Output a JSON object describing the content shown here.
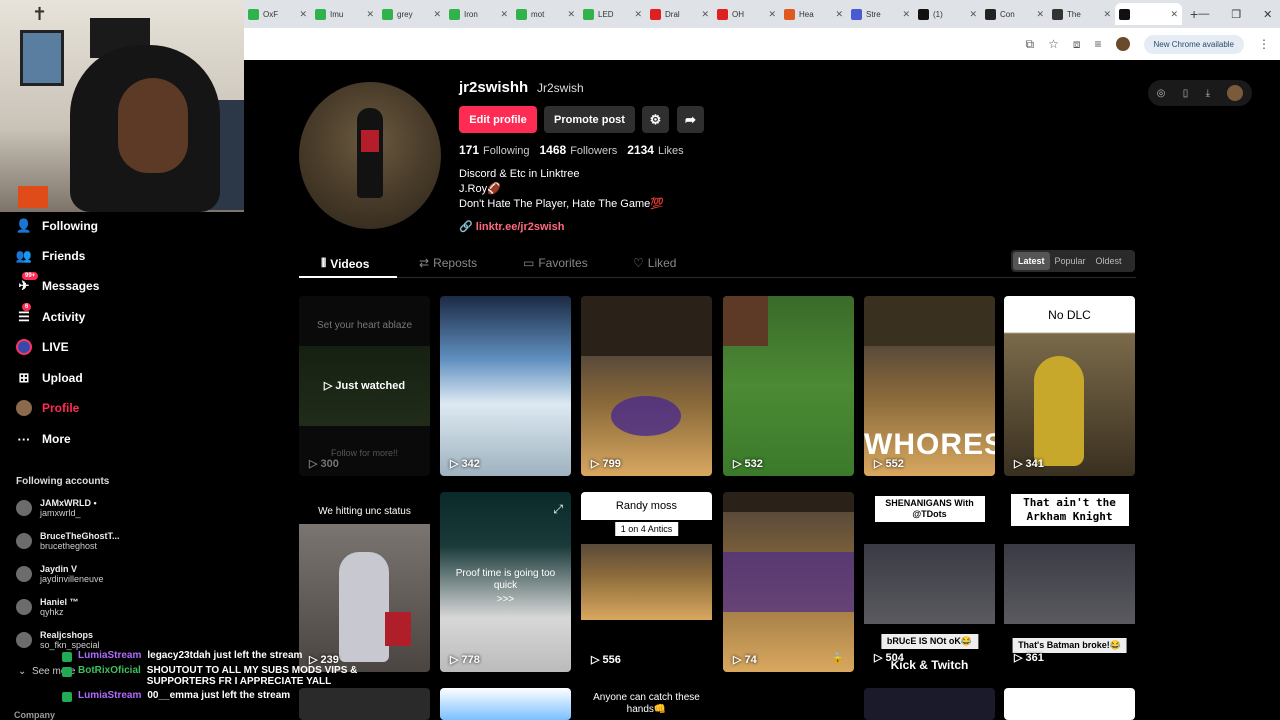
{
  "browser": {
    "tabs": [
      {
        "label": "OxF",
        "color": "#2fb34a"
      },
      {
        "label": "Imu",
        "color": "#2fb34a"
      },
      {
        "label": "grey",
        "color": "#2fb34a"
      },
      {
        "label": "Iron",
        "color": "#2fb34a"
      },
      {
        "label": "mot",
        "color": "#2fb34a"
      },
      {
        "label": "LED",
        "color": "#2fb34a"
      },
      {
        "label": "Dral",
        "color": "#e02020"
      },
      {
        "label": "OH",
        "color": "#e02020"
      },
      {
        "label": "Hea",
        "color": "#e05a20"
      },
      {
        "label": "Stre",
        "color": "#4a5ad0"
      },
      {
        "label": "(1)",
        "color": "#111111"
      },
      {
        "label": "Con",
        "color": "#222222"
      },
      {
        "label": "The",
        "color": "#333333"
      },
      {
        "label": "",
        "color": "#111111"
      }
    ],
    "new_chrome": "New Chrome available"
  },
  "nav": {
    "following": "Following",
    "friends": "Friends",
    "messages": "Messages",
    "messages_badge": "99+",
    "activity": "Activity",
    "activity_badge": "6",
    "live": "LIVE",
    "upload": "Upload",
    "profile": "Profile",
    "more": "More"
  },
  "following_accounts": {
    "title": "Following accounts",
    "items": [
      {
        "name": "JAMxWRLD •",
        "user": "jamxwrld_"
      },
      {
        "name": "BruceTheGhostT...",
        "user": "brucetheghost"
      },
      {
        "name": "Jaydin V",
        "user": "jaydinvilleneuve"
      },
      {
        "name": "Haniel ™",
        "user": "qyhkz"
      },
      {
        "name": "Realjcshops",
        "user": "so_fkn_special"
      }
    ],
    "see_more": "See more",
    "company": "Company"
  },
  "chat": [
    {
      "user": "LumiaStream",
      "msg": "legacy23tdah just left the stream",
      "cls": "u1"
    },
    {
      "user": "BotRixOficial",
      "msg": "SHOUTOUT TO ALL MY SUBS MODS VIPS & SUPPORTERS FR I APPRECIATE YALL",
      "cls": "u2"
    },
    {
      "user": "LumiaStream",
      "msg": "00__emma just left the stream",
      "cls": "u1"
    }
  ],
  "profile": {
    "username": "jr2swishh",
    "nickname": "Jr2swish",
    "edit_label": "Edit profile",
    "promote_label": "Promote post",
    "following_count": "171",
    "following_label": "Following",
    "followers_count": "1468",
    "followers_label": "Followers",
    "likes_count": "2134",
    "likes_label": "Likes",
    "bio_line1": "Discord & Etc in Linktree",
    "bio_line2": "J.Roy🏈",
    "bio_line3": "Don't Hate The Player, Hate The Game💯",
    "link": "linktr.ee/jr2swish"
  },
  "tabs": {
    "videos": "Videos",
    "reposts": "Reposts",
    "favorites": "Favorites",
    "liked": "Liked"
  },
  "sort": {
    "latest": "Latest",
    "popular": "Popular",
    "oldest": "Oldest"
  },
  "videos": [
    {
      "views": "300",
      "top": "Set your heart ablaze",
      "mid": "Just watched",
      "bottom": "Follow for more!!"
    },
    {
      "views": "342"
    },
    {
      "views": "799"
    },
    {
      "views": "532"
    },
    {
      "views": "552",
      "overlay": "WHORES"
    },
    {
      "views": "341",
      "top": "No DLC"
    },
    {
      "views": "239",
      "top": "We hitting unc status"
    },
    {
      "views": "778",
      "mid": "Proof time is going too quick",
      "arrows": ">>>"
    },
    {
      "views": "556",
      "top": "Randy moss",
      "tag": "1 on 4 Antics"
    },
    {
      "views": "74"
    },
    {
      "views": "504",
      "top": "SHENANIGANS With @TDots",
      "mid": "bRUcE IS NOt oK😂",
      "bottom": "Kick & Twitch"
    },
    {
      "views": "361",
      "top": "That ain't the Arkham Knight",
      "mid": "That's Batman broke!😂"
    },
    {
      "views": "",
      "top": "Anyone can catch these hands👊"
    }
  ]
}
